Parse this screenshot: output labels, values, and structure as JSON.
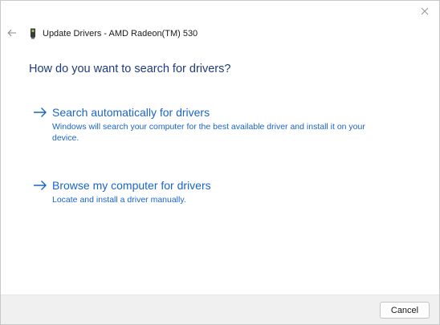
{
  "window": {
    "title": "Update Drivers - AMD Radeon(TM) 530",
    "icons": {
      "close": "close-icon",
      "back": "back-arrow-icon",
      "device": "display-adapter-icon"
    }
  },
  "main": {
    "heading": "How do you want to search for drivers?",
    "options": [
      {
        "title": "Search automatically for drivers",
        "description": "Windows will search your computer for the best available driver and install it on your device.",
        "icon": "arrow-right-icon"
      },
      {
        "title": "Browse my computer for drivers",
        "description": "Locate and install a driver manually.",
        "icon": "arrow-right-icon"
      }
    ]
  },
  "footer": {
    "cancel_label": "Cancel"
  },
  "colors": {
    "heading": "#1f3c7a",
    "link": "#1a64c8",
    "footer_bg": "#f0f0f0"
  }
}
